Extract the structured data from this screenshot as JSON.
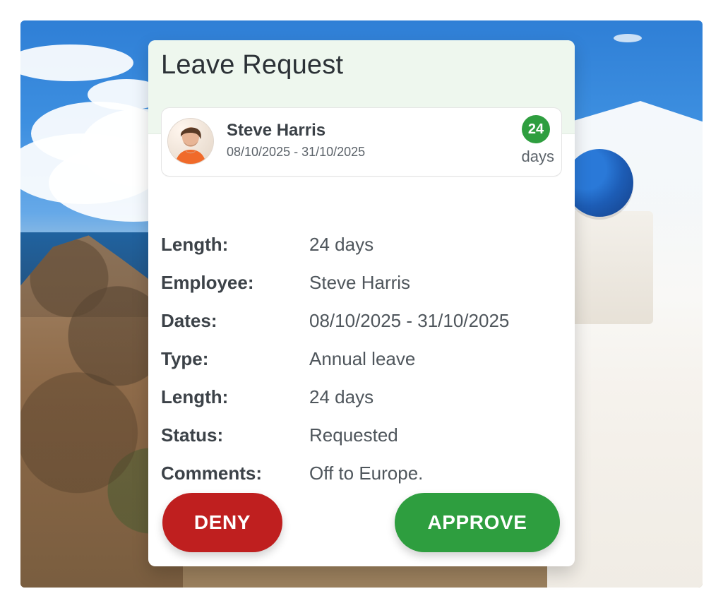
{
  "card": {
    "title": "Leave Request"
  },
  "summary": {
    "employee_name": "Steve Harris",
    "date_range": "08/10/2025 - 31/10/2025",
    "days_count": "24",
    "days_unit": "days"
  },
  "details": {
    "rows": [
      {
        "label": "Length:",
        "value": "24 days"
      },
      {
        "label": "Employee:",
        "value": "Steve Harris"
      },
      {
        "label": "Dates:",
        "value": "08/10/2025 - 31/10/2025"
      },
      {
        "label": "Type:",
        "value": "Annual leave"
      },
      {
        "label": "Length:",
        "value": "24 days"
      },
      {
        "label": "Status:",
        "value": "Requested"
      },
      {
        "label": "Comments:",
        "value": "Off to Europe."
      }
    ]
  },
  "actions": {
    "deny_label": "DENY",
    "approve_label": "APPROVE"
  },
  "colors": {
    "approve_green": "#2e9e3f",
    "deny_red": "#bf1f1f",
    "header_tint": "#eef7ee"
  },
  "icons": {
    "avatar": "person-avatar"
  }
}
